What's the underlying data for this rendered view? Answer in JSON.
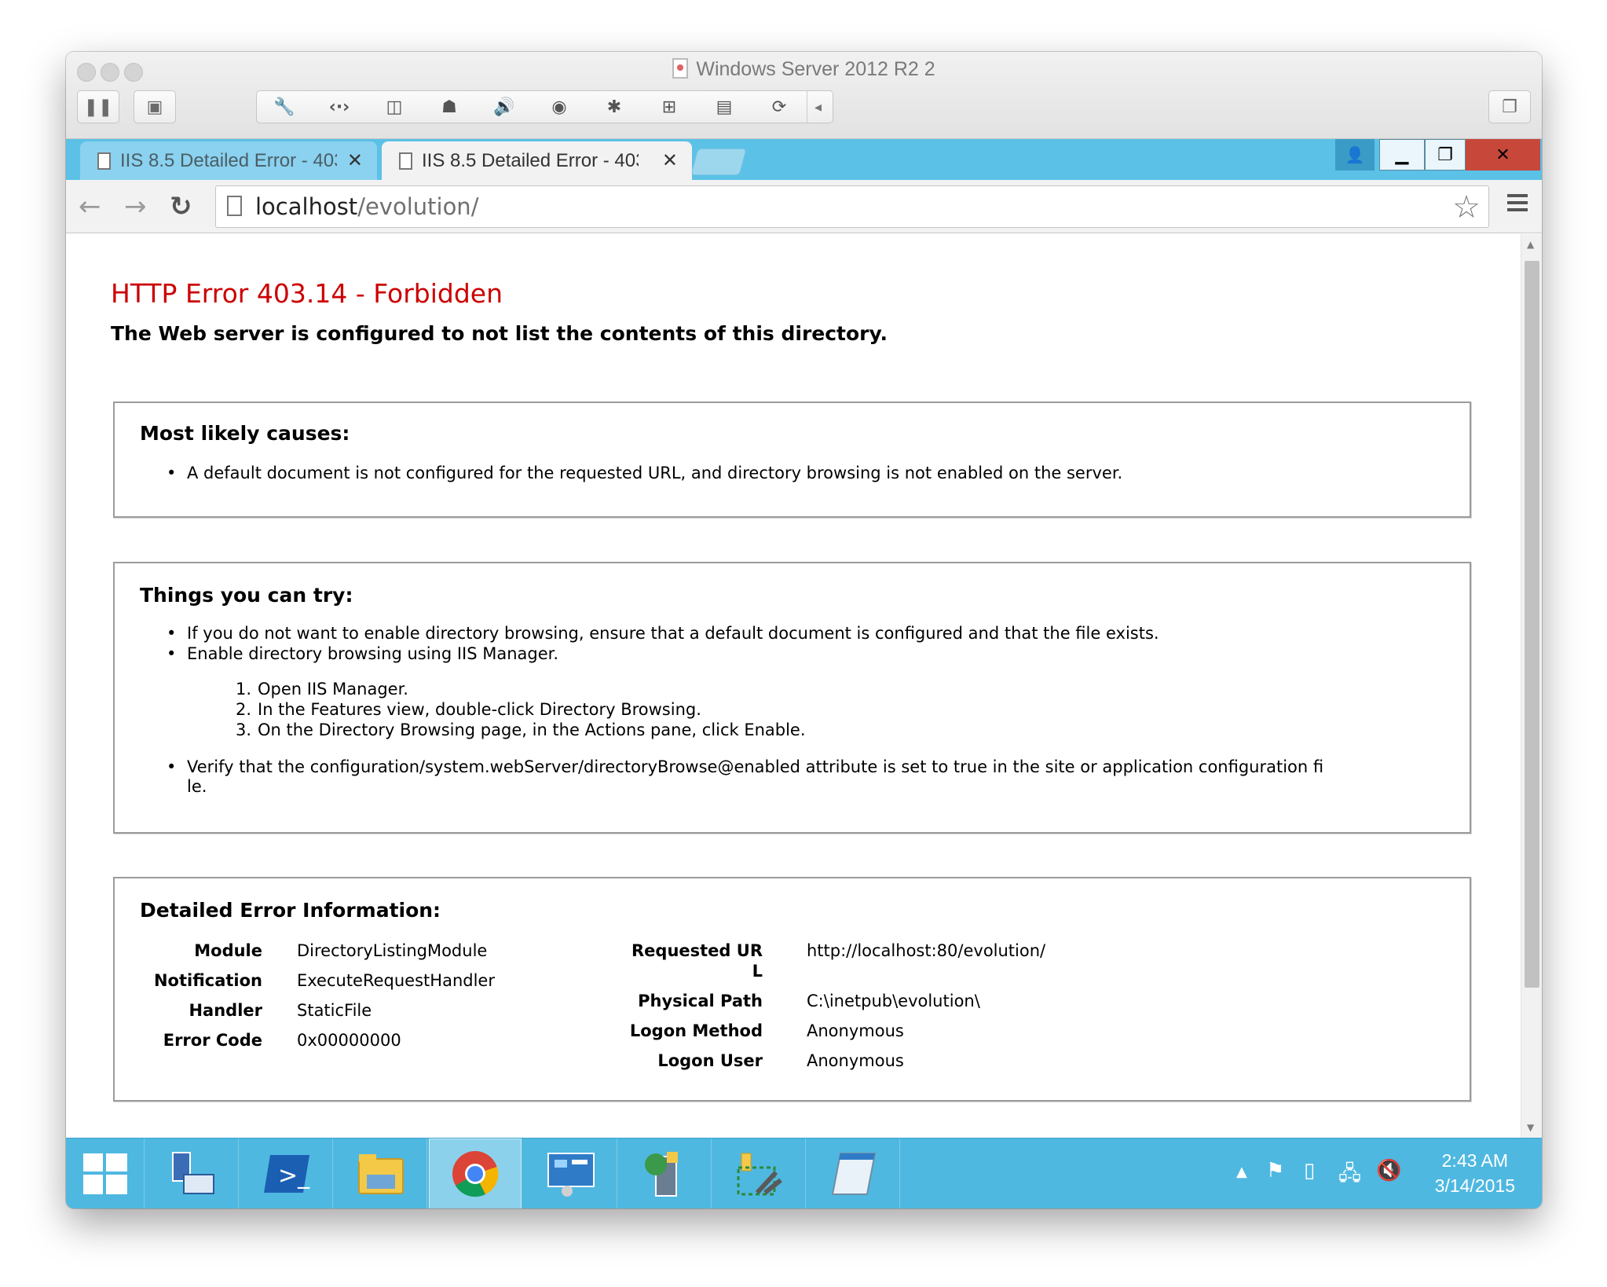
{
  "mac_window": {
    "title": "Windows Server 2012 R2 2"
  },
  "browser": {
    "tabs": [
      {
        "label": "IIS 8.5 Detailed Error - 403",
        "active": false
      },
      {
        "label": "IIS 8.5 Detailed Error - 403",
        "active": true
      }
    ],
    "url_host": "localhost",
    "url_path": "/evolution/"
  },
  "page": {
    "title": "HTTP Error 403.14 - Forbidden",
    "subtitle": "The Web server is configured to not list the contents of this directory.",
    "causes": {
      "heading": "Most likely causes:",
      "items": [
        "A default document is not configured for the requested URL, and directory browsing is not enabled on the server."
      ]
    },
    "try": {
      "heading": "Things you can try:",
      "items": [
        "If you do not want to enable directory browsing, ensure that a default document is configured and that the file exists.",
        "Enable directory browsing using IIS Manager."
      ],
      "steps": [
        "Open IIS Manager.",
        "In the Features view, double-click Directory Browsing.",
        "On the Directory Browsing page, in the Actions pane, click Enable."
      ],
      "last_line1": "Verify that the configuration/system.webServer/directoryBrowse@enabled attribute is set to true in the site or application configuration fi",
      "last_line2": "le."
    },
    "details": {
      "heading": "Detailed Error Information:",
      "left": [
        {
          "label": "Module",
          "value": "DirectoryListingModule"
        },
        {
          "label": "Notification",
          "value": "ExecuteRequestHandler"
        },
        {
          "label": "Handler",
          "value": "StaticFile"
        },
        {
          "label": "Error Code",
          "value": "0x00000000"
        }
      ],
      "right_url_label_1": "Requested UR",
      "right_url_label_2": "L",
      "right_url_value": "http://localhost:80/evolution/",
      "right": [
        {
          "label": "Physical Path",
          "value": "C:\\inetpub\\evolution\\"
        },
        {
          "label": "Logon Method",
          "value": "Anonymous"
        },
        {
          "label": "Logon User",
          "value": "Anonymous"
        }
      ]
    }
  },
  "taskbar": {
    "time": "2:43 AM",
    "date": "3/14/2015"
  }
}
